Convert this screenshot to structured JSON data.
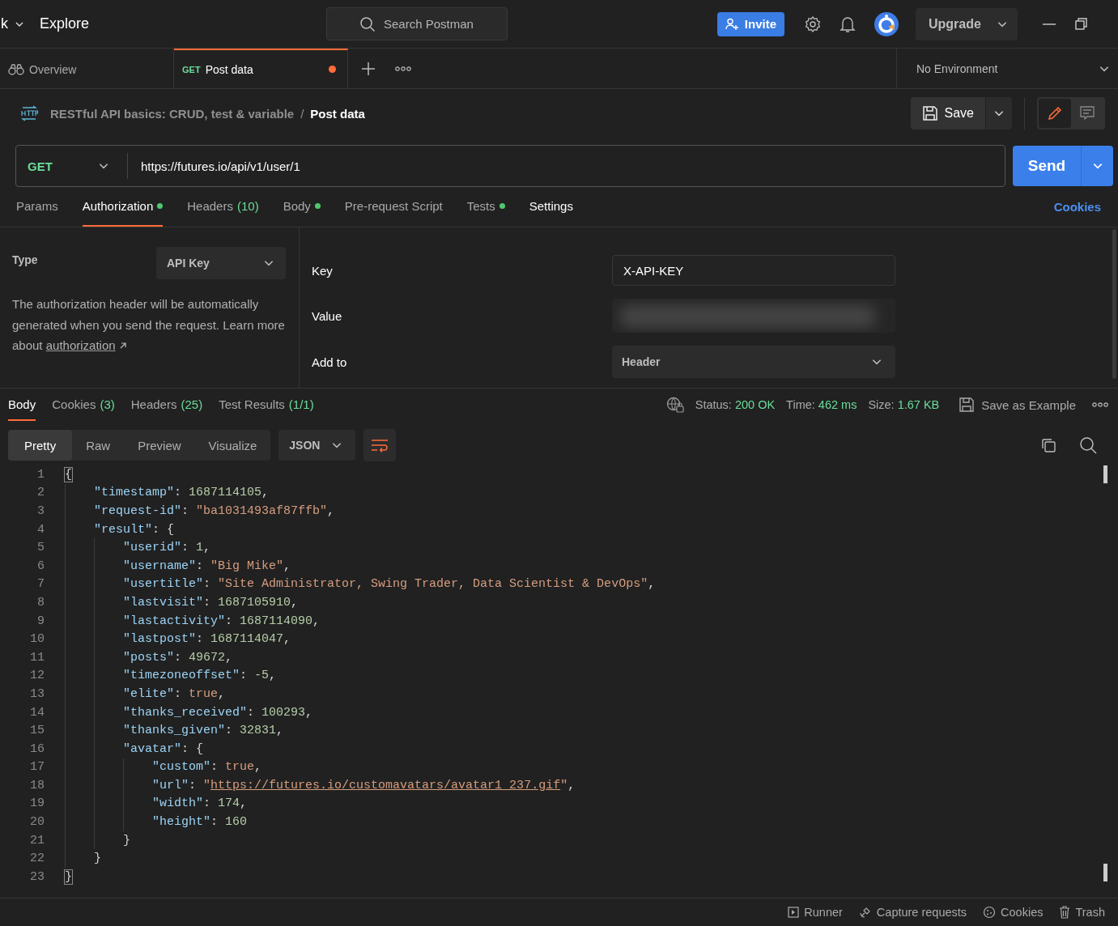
{
  "top_bar": {
    "workspace_fragment": "k",
    "explore": "Explore",
    "search": {
      "placeholder": "Search Postman"
    },
    "invite": "Invite",
    "upgrade": "Upgrade"
  },
  "tabs": [
    {
      "kind": "overview",
      "label": "Overview",
      "selected": false,
      "unsaved": false
    },
    {
      "kind": "request",
      "method": "GET",
      "label": "Post data",
      "selected": true,
      "unsaved": true
    }
  ],
  "environment": "No Environment",
  "breadcrumb": {
    "collection": "RESTful API basics: CRUD, test & variable",
    "separator": "/",
    "request": "Post data"
  },
  "save": "Save",
  "mode_toggle": [
    {
      "kind": "edit",
      "selected": true
    },
    {
      "kind": "comment",
      "selected": false
    }
  ],
  "request": {
    "method": "GET",
    "url": "https://futures.io/api/v1/user/1",
    "send": "Send"
  },
  "request_tabs": [
    {
      "label": "Params",
      "selected": false,
      "has_content": false
    },
    {
      "label": "Authorization",
      "selected": true,
      "has_content": true
    },
    {
      "label": "Headers",
      "count": "(10)",
      "selected": false,
      "has_content": false
    },
    {
      "label": "Body",
      "selected": false,
      "has_content": true
    },
    {
      "label": "Pre-request Script",
      "selected": false,
      "has_content": false
    },
    {
      "label": "Tests",
      "selected": false,
      "has_content": true
    },
    {
      "label": "Settings",
      "selected": false,
      "has_content": false
    }
  ],
  "cookies_link": "Cookies",
  "auth": {
    "type_label": "Type",
    "type": "API Key",
    "description": "The authorization header will be automatically generated when you send the request. Learn more about",
    "link": "authorization",
    "fields": [
      {
        "kind": "text",
        "label": "Key",
        "value": "X-API-KEY"
      },
      {
        "kind": "blurred",
        "label": "Value"
      },
      {
        "kind": "select",
        "label": "Add to",
        "value": "Header"
      }
    ]
  },
  "response_tabs": [
    {
      "label": "Body",
      "selected": true
    },
    {
      "label": "Cookies",
      "count": "(3)",
      "selected": false
    },
    {
      "label": "Headers",
      "count": "(25)",
      "selected": false
    },
    {
      "label": "Test Results",
      "count": "(1/1)",
      "selected": false
    }
  ],
  "response_meta": [
    {
      "label": "Status:",
      "value": "200 OK"
    },
    {
      "label": "Time:",
      "value": "462 ms"
    },
    {
      "label": "Size:",
      "value": "1.67 KB"
    }
  ],
  "save_example": "Save as Example",
  "view_modes": [
    {
      "label": "Pretty",
      "selected": true
    },
    {
      "label": "Raw",
      "selected": false
    },
    {
      "label": "Preview",
      "selected": false
    },
    {
      "label": "Visualize",
      "selected": false
    }
  ],
  "format": "JSON",
  "code_lines": [
    {
      "number": "1",
      "tokens": [
        {
          "kind": "brace_match",
          "text": "{"
        }
      ]
    },
    {
      "number": "2",
      "tokens": [
        {
          "kind": "key",
          "text": "    \"timestamp\""
        },
        {
          "kind": "punct",
          "text": ": "
        },
        {
          "kind": "number",
          "text": "1687114105"
        },
        {
          "kind": "punct",
          "text": ","
        }
      ]
    },
    {
      "number": "3",
      "tokens": [
        {
          "kind": "key",
          "text": "    \"request-id\""
        },
        {
          "kind": "punct",
          "text": ": "
        },
        {
          "kind": "string",
          "text": "\"ba1031493af87ffb\""
        },
        {
          "kind": "punct",
          "text": ","
        }
      ]
    },
    {
      "number": "4",
      "tokens": [
        {
          "kind": "key",
          "text": "    \"result\""
        },
        {
          "kind": "punct",
          "text": ": {"
        }
      ]
    },
    {
      "number": "5",
      "tokens": [
        {
          "kind": "key",
          "text": "        \"userid\""
        },
        {
          "kind": "punct",
          "text": ": "
        },
        {
          "kind": "number",
          "text": "1"
        },
        {
          "kind": "punct",
          "text": ","
        }
      ]
    },
    {
      "number": "6",
      "tokens": [
        {
          "kind": "key",
          "text": "        \"username\""
        },
        {
          "kind": "punct",
          "text": ": "
        },
        {
          "kind": "string",
          "text": "\"Big Mike\""
        },
        {
          "kind": "punct",
          "text": ","
        }
      ]
    },
    {
      "number": "7",
      "tokens": [
        {
          "kind": "key",
          "text": "        \"usertitle\""
        },
        {
          "kind": "punct",
          "text": ": "
        },
        {
          "kind": "string",
          "text": "\"Site Administrator, Swing Trader, Data Scientist & DevOps\""
        },
        {
          "kind": "punct",
          "text": ","
        }
      ]
    },
    {
      "number": "8",
      "tokens": [
        {
          "kind": "key",
          "text": "        \"lastvisit\""
        },
        {
          "kind": "punct",
          "text": ": "
        },
        {
          "kind": "number",
          "text": "1687105910"
        },
        {
          "kind": "punct",
          "text": ","
        }
      ]
    },
    {
      "number": "9",
      "tokens": [
        {
          "kind": "key",
          "text": "        \"lastactivity\""
        },
        {
          "kind": "punct",
          "text": ": "
        },
        {
          "kind": "number",
          "text": "1687114090"
        },
        {
          "kind": "punct",
          "text": ","
        }
      ]
    },
    {
      "number": "10",
      "tokens": [
        {
          "kind": "key",
          "text": "        \"lastpost\""
        },
        {
          "kind": "punct",
          "text": ": "
        },
        {
          "kind": "number",
          "text": "1687114047"
        },
        {
          "kind": "punct",
          "text": ","
        }
      ]
    },
    {
      "number": "11",
      "tokens": [
        {
          "kind": "key",
          "text": "        \"posts\""
        },
        {
          "kind": "punct",
          "text": ": "
        },
        {
          "kind": "number",
          "text": "49672"
        },
        {
          "kind": "punct",
          "text": ","
        }
      ]
    },
    {
      "number": "12",
      "tokens": [
        {
          "kind": "key",
          "text": "        \"timezoneoffset\""
        },
        {
          "kind": "punct",
          "text": ": "
        },
        {
          "kind": "number",
          "text": "-5"
        },
        {
          "kind": "punct",
          "text": ","
        }
      ]
    },
    {
      "number": "13",
      "tokens": [
        {
          "kind": "key",
          "text": "        \"elite\""
        },
        {
          "kind": "punct",
          "text": ": "
        },
        {
          "kind": "bool",
          "text": "true"
        },
        {
          "kind": "punct",
          "text": ","
        }
      ]
    },
    {
      "number": "14",
      "tokens": [
        {
          "kind": "key",
          "text": "        \"thanks_received\""
        },
        {
          "kind": "punct",
          "text": ": "
        },
        {
          "kind": "number",
          "text": "100293"
        },
        {
          "kind": "punct",
          "text": ","
        }
      ]
    },
    {
      "number": "15",
      "tokens": [
        {
          "kind": "key",
          "text": "        \"thanks_given\""
        },
        {
          "kind": "punct",
          "text": ": "
        },
        {
          "kind": "number",
          "text": "32831"
        },
        {
          "kind": "punct",
          "text": ","
        }
      ]
    },
    {
      "number": "16",
      "tokens": [
        {
          "kind": "key",
          "text": "        \"avatar\""
        },
        {
          "kind": "punct",
          "text": ": {"
        }
      ]
    },
    {
      "number": "17",
      "tokens": [
        {
          "kind": "key",
          "text": "            \"custom\""
        },
        {
          "kind": "punct",
          "text": ": "
        },
        {
          "kind": "bool",
          "text": "true"
        },
        {
          "kind": "punct",
          "text": ","
        }
      ]
    },
    {
      "number": "18",
      "tokens": [
        {
          "kind": "key",
          "text": "            \"url\""
        },
        {
          "kind": "punct",
          "text": ": "
        },
        {
          "kind": "string",
          "text": "\""
        },
        {
          "kind": "link",
          "text": "https://futures.io/customavatars/avatar1_237.gif"
        },
        {
          "kind": "string",
          "text": "\""
        },
        {
          "kind": "punct",
          "text": ","
        }
      ]
    },
    {
      "number": "19",
      "tokens": [
        {
          "kind": "key",
          "text": "            \"width\""
        },
        {
          "kind": "punct",
          "text": ": "
        },
        {
          "kind": "number",
          "text": "174"
        },
        {
          "kind": "punct",
          "text": ","
        }
      ]
    },
    {
      "number": "20",
      "tokens": [
        {
          "kind": "key",
          "text": "            \"height\""
        },
        {
          "kind": "punct",
          "text": ": "
        },
        {
          "kind": "number",
          "text": "160"
        }
      ]
    },
    {
      "number": "21",
      "tokens": [
        {
          "kind": "punct",
          "text": "        }"
        }
      ]
    },
    {
      "number": "22",
      "tokens": [
        {
          "kind": "punct",
          "text": "    }"
        }
      ]
    },
    {
      "number": "23",
      "tokens": [
        {
          "kind": "brace_match",
          "text": "}"
        }
      ]
    }
  ],
  "footer": [
    {
      "kind": "runner",
      "label": "Runner"
    },
    {
      "kind": "capture",
      "label": "Capture requests"
    },
    {
      "kind": "cookies",
      "label": "Cookies"
    },
    {
      "kind": "trash",
      "label": "Trash"
    }
  ]
}
